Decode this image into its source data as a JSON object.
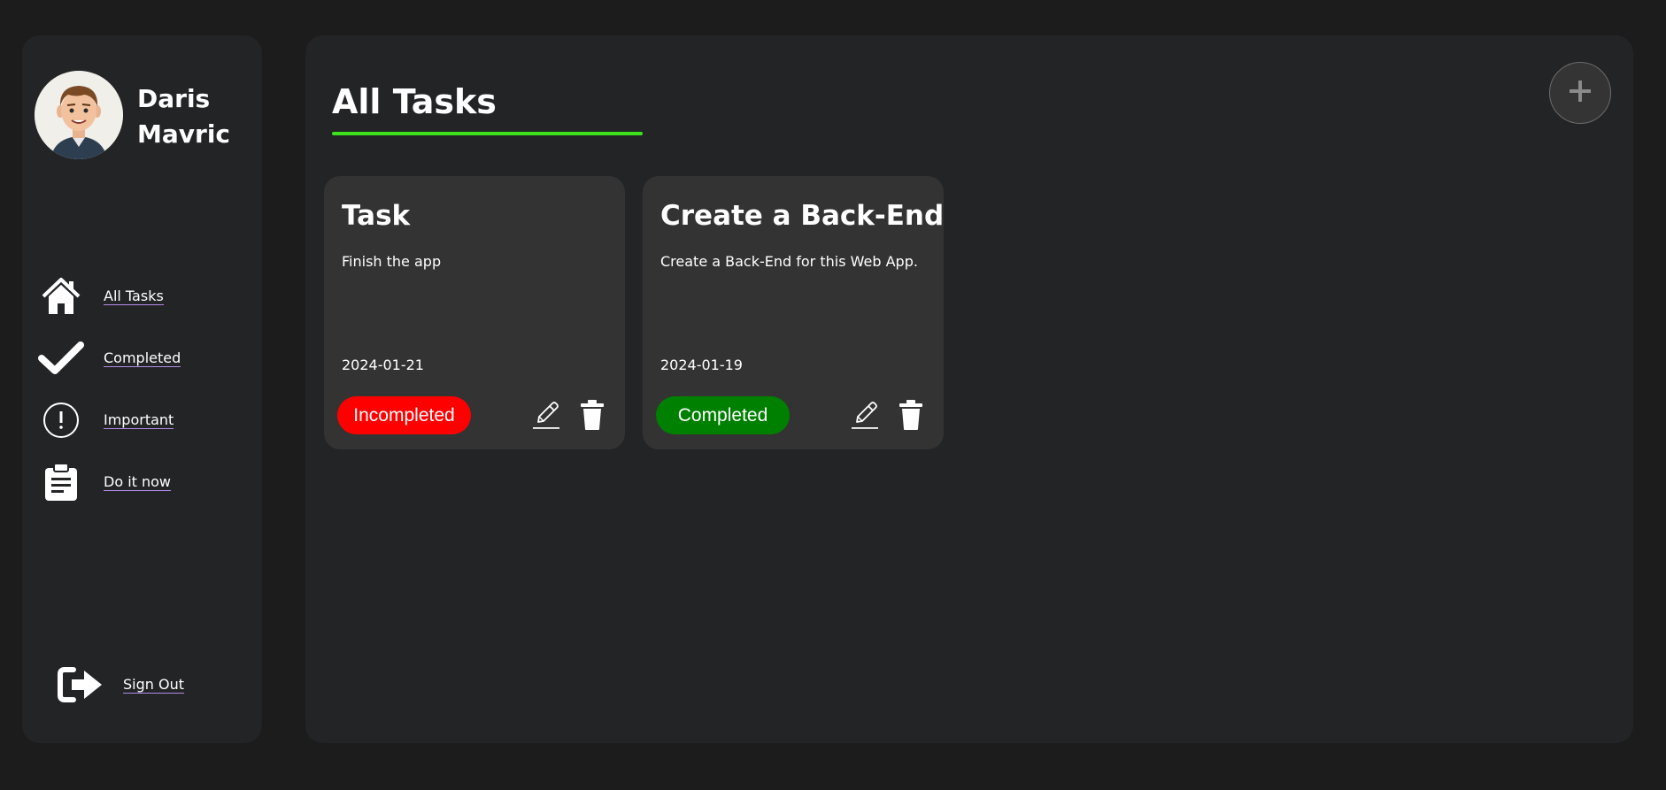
{
  "sidebar": {
    "profile": {
      "name": "Daris Mavric"
    },
    "nav_items": [
      {
        "label": "All Tasks",
        "icon": "home-icon"
      },
      {
        "label": "Completed",
        "icon": "checkmark-icon"
      },
      {
        "label": "Important",
        "icon": "exclamation-circle-icon"
      },
      {
        "label": "Do it now",
        "icon": "clipboard-icon"
      }
    ],
    "sign_out": {
      "label": "Sign Out",
      "icon": "sign-out-icon"
    }
  },
  "main": {
    "title": "All Tasks",
    "add_button_icon": "plus-icon",
    "tasks": [
      {
        "title": "Task",
        "description": "Finish the app",
        "date": "2024-01-21",
        "status": "Incompleted",
        "status_color": "#ff0000"
      },
      {
        "title": "Create a Back-End",
        "description": "Create a Back-End for this Web App.",
        "date": "2024-01-19",
        "status": "Completed",
        "status_color": "#008000"
      }
    ]
  },
  "colors": {
    "background": "#1c1c1c",
    "panel": "#232426",
    "card": "#333333",
    "accent_underline": "#3ce21b",
    "incomplete": "#ff0000",
    "complete": "#008000"
  }
}
